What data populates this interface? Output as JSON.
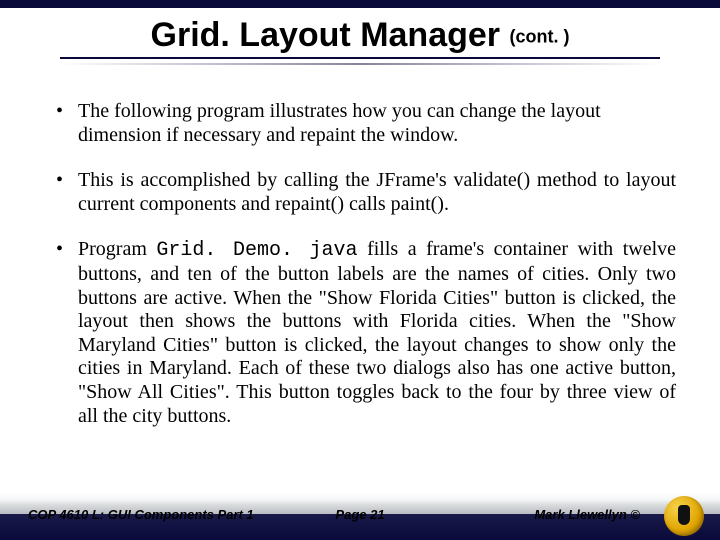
{
  "title_main": "Grid. Layout Manager ",
  "title_cont": "(cont. )",
  "bullets": {
    "b1": "The following program illustrates how you can change the layout dimension if necessary and repaint the window.",
    "b2": "This is accomplished by calling the JFrame's validate() method to layout current components and repaint() calls paint().",
    "b3_pre": "Program ",
    "b3_code": "Grid. Demo. java",
    "b3_post": " fills a frame's container with twelve buttons, and ten of the button labels are the names of cities.  Only two buttons are active.  When the \"Show Florida Cities\" button is clicked, the layout then shows the buttons with Florida cities.  When the \"Show Maryland Cities\" button is clicked, the layout changes to show only the cities in Maryland.  Each of these two dialogs also has one active button, \"Show All Cities\".  This button toggles back to the four by three view of all the city buttons."
  },
  "footer": {
    "left": "COP 4610 L: GUI Components Part 1",
    "center": "Page 21",
    "right": "Mark Llewellyn ©"
  }
}
